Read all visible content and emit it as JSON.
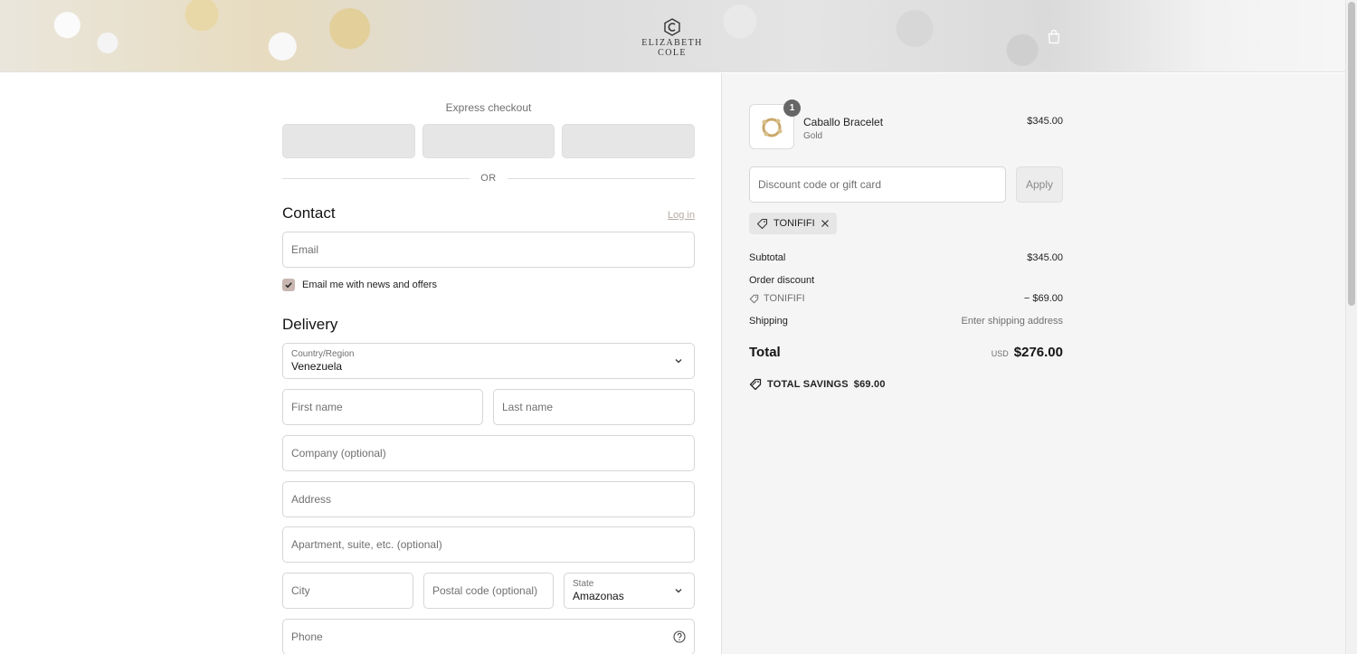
{
  "brand": {
    "name": "ELIZABETH COLE"
  },
  "express": {
    "title": "Express checkout",
    "or_label": "OR"
  },
  "contact": {
    "title": "Contact",
    "login_label": "Log in",
    "email_placeholder": "Email",
    "newsletter_label": "Email me with news and offers",
    "newsletter_checked": true
  },
  "delivery": {
    "title": "Delivery",
    "country_label": "Country/Region",
    "country_value": "Venezuela",
    "first_name_placeholder": "First name",
    "last_name_placeholder": "Last name",
    "company_placeholder": "Company (optional)",
    "address_placeholder": "Address",
    "apartment_placeholder": "Apartment, suite, etc. (optional)",
    "city_placeholder": "City",
    "postal_placeholder": "Postal code (optional)",
    "state_label": "State",
    "state_value": "Amazonas",
    "phone_placeholder": "Phone"
  },
  "summary": {
    "item": {
      "name": "Caballo Bracelet",
      "variant": "Gold",
      "price": "$345.00",
      "quantity": "1"
    },
    "discount_placeholder": "Discount code or gift card",
    "apply_label": "Apply",
    "applied_code": "TONIFIFI",
    "subtotal_label": "Subtotal",
    "subtotal_value": "$345.00",
    "order_discount_label": "Order discount",
    "discount_code": "TONIFIFI",
    "discount_value": "− $69.00",
    "shipping_label": "Shipping",
    "shipping_value": "Enter shipping address",
    "total_label": "Total",
    "currency": "USD",
    "total_value": "$276.00",
    "savings_label": "TOTAL SAVINGS",
    "savings_value": "$69.00"
  },
  "colors": {
    "accent_checkbox": "#c8b7b1",
    "panel_bg": "#f5f5f5",
    "link": "#b5aca5"
  }
}
